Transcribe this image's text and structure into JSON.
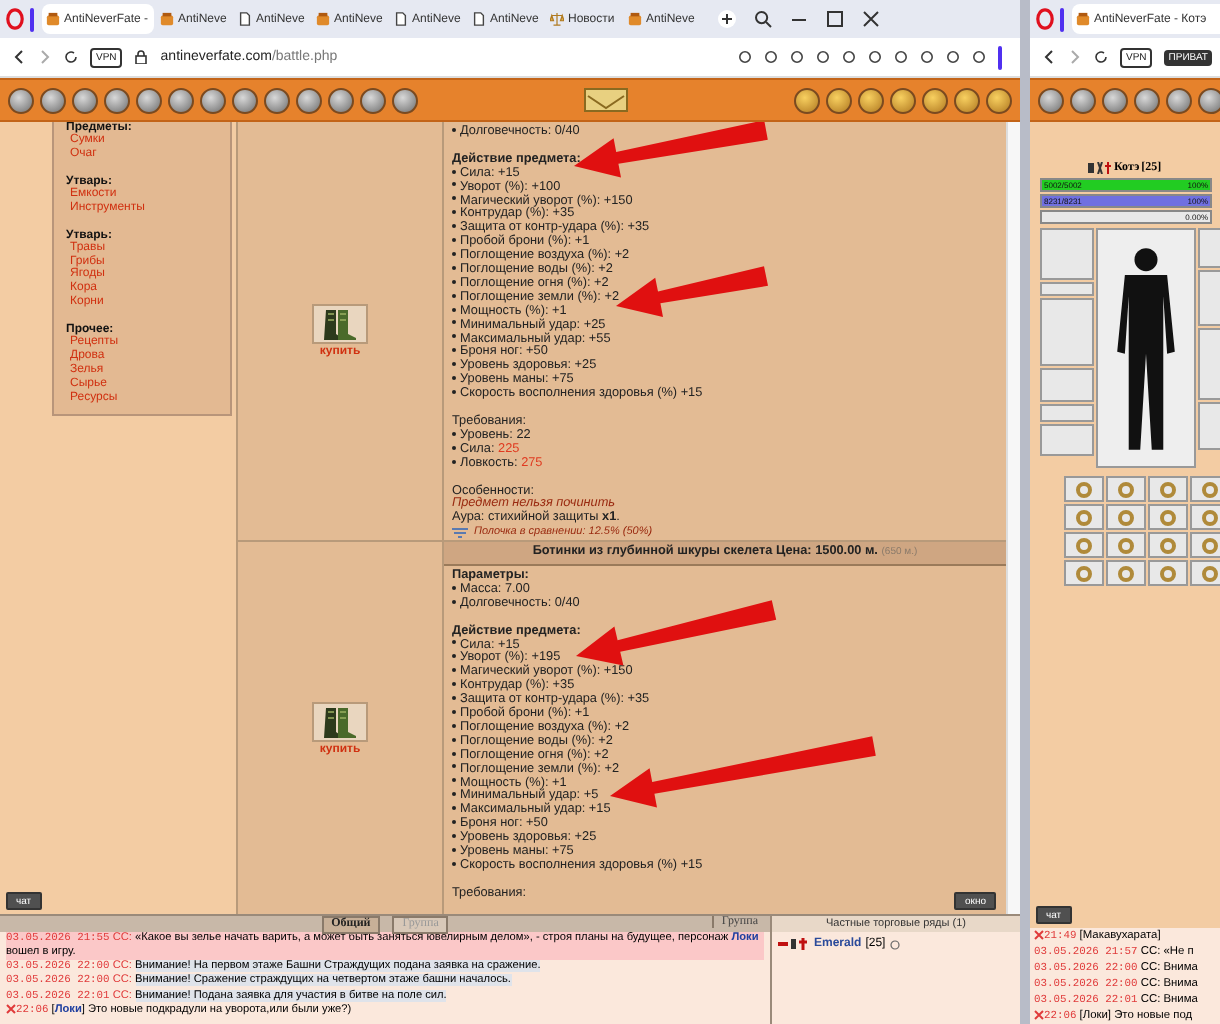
{
  "main_window": {
    "tabs": [
      {
        "title": "AntiNeverFate -",
        "kind": "game",
        "selected": true
      },
      {
        "title": "AntiNeve",
        "kind": "game",
        "selected": false
      },
      {
        "title": "AntiNeve",
        "kind": "doc",
        "selected": false
      },
      {
        "title": "AntiNeve",
        "kind": "game",
        "selected": false
      },
      {
        "title": "AntiNeve",
        "kind": "doc",
        "selected": false
      },
      {
        "title": "AntiNeve",
        "kind": "doc",
        "selected": false
      },
      {
        "title": "Новости",
        "kind": "news",
        "selected": false
      },
      {
        "title": "AntiNeve",
        "kind": "game",
        "selected": false
      }
    ],
    "address": {
      "vpn": "VPN",
      "domain": "antineverfate.com",
      "path": "/battle.php"
    },
    "sidebar": [
      {
        "title": "Предметы:",
        "items": [
          "Сумки",
          "Очаг"
        ]
      },
      {
        "title": "Утварь:",
        "items": [
          "Емкости",
          "Инструменты"
        ]
      },
      {
        "title": "Утварь:",
        "items": [
          "Травы",
          "Грибы",
          "Ягоды",
          "Кора",
          "Корни"
        ]
      },
      {
        "title": "Прочее:",
        "items": [
          "Рецепты",
          "Дрова",
          "Зелья",
          "Сырье",
          "Ресурсы"
        ]
      }
    ],
    "items": [
      {
        "buy": "купить",
        "sections": [
          {
            "kind": "stats",
            "lines": [
              "Долговечность: 0/40"
            ]
          },
          {
            "kind": "stats",
            "title": "Действие предмета:",
            "lines": [
              "Сила: +15",
              "Уворот (%): +100",
              "Магический уворот (%): +150",
              "Контрудар (%): +35",
              "Защита от контр-удара (%): +35",
              "Пробой брони (%): +1",
              "Поглощение воздуха (%): +2",
              "Поглощение воды (%): +2",
              "Поглощение огня (%): +2",
              "Поглощение земли (%): +2",
              "Мощность (%): +1",
              "Минимальный удар: +25",
              "Максимальный удар: +55",
              "Броня ног: +50",
              "Уровень здоровья: +25",
              "Уровень маны: +75",
              "Скорость восполнения здоровья (%) +15"
            ]
          },
          {
            "kind": "requirements",
            "title": "Требования:",
            "lines": [
              {
                "label": "Уровень:",
                "value": "22",
                "unmet": false
              },
              {
                "label": "Сила:",
                "value": "225",
                "unmet": true
              },
              {
                "label": "Ловкость:",
                "value": "275",
                "unmet": true
              }
            ]
          },
          {
            "kind": "features",
            "title": "Особенности:",
            "note": "Предмет нельзя починить",
            "aura": "Аура: стихийной защиты **x1**.",
            "compare": "Полочка в сравнении: 12.5% (50%)"
          }
        ]
      },
      {
        "buy": "купить",
        "header": {
          "title": "Ботинки из глубинной шкуры скелета Цена: 1500.00 м.",
          "note": "(650 м.)"
        },
        "sections": [
          {
            "kind": "stats",
            "title": "Параметры:",
            "lines": [
              "Масса: 7.00",
              "Долговечность: 0/40"
            ]
          },
          {
            "kind": "stats",
            "title": "Действие предмета:",
            "lines": [
              "Сила: +15",
              "Уворот (%): +195",
              "Магический уворот (%): +150",
              "Контрудар (%): +35",
              "Защита от контр-удара (%): +35",
              "Пробой брони (%): +1",
              "Поглощение воздуха (%): +2",
              "Поглощение воды (%): +2",
              "Поглощение огня (%): +2",
              "Поглощение земли (%): +2",
              "Мощность (%): +1",
              "Минимальный удар: +5",
              "Максимальный удар: +15",
              "Броня ног: +50",
              "Уровень здоровья: +25",
              "Уровень маны: +75",
              "Скорость восполнения здоровья (%) +15"
            ]
          },
          {
            "kind": "requirements",
            "title": "Требования:"
          }
        ]
      }
    ],
    "chat_button": "чат",
    "window_button": "окно",
    "chat_tabs": [
      {
        "label": "Общий",
        "selected": true
      },
      {
        "label": "Группа",
        "selected": false
      }
    ],
    "chat_tab_right": "Группа",
    "chat": [
      {
        "kind": "system",
        "highlighted": true,
        "time": "03.05.2026 21:55",
        "sender": "СС:",
        "text": "«Какое вы зелье начать варить, а может быть заняться ювелирным делом», - строя планы на будущее, персонаж **Локи** вошел в игру."
      },
      {
        "kind": "system",
        "highlighted": false,
        "time": "03.05.2026 22:00",
        "sender": "СС:",
        "text": "Внимание! На первом этаже Башни Страждущих подана заявка на сражение."
      },
      {
        "kind": "system",
        "highlighted": false,
        "time": "03.05.2026 22:00",
        "sender": "СС:",
        "text": "Внимание! Сражение страждущих на четвертом этаже башни началось."
      },
      {
        "kind": "system",
        "highlighted": false,
        "time": "03.05.2026 22:01",
        "sender": "СС:",
        "text": "Внимание! Подана заявка для участия в битве на поле сил."
      },
      {
        "kind": "player",
        "highlighted": false,
        "time": "22:06",
        "text": "[**Локи**] Это новые подкрадули на уворота,или были уже?)"
      }
    ],
    "trade": {
      "title": "Частные торговые ряды (1)",
      "players": [
        {
          "name": "Emerald",
          "level": "[25]"
        }
      ]
    }
  },
  "side_window": {
    "tab": "AntiNeverFate - Котэ",
    "vpn": "VPN",
    "private": "ПРИВАТ",
    "character": {
      "name": "Котэ",
      "level": "[25]",
      "bars": [
        {
          "text": "5002/5002",
          "pct": "100%",
          "level": 1,
          "color": "#22cc22"
        },
        {
          "text": "8231/8231",
          "pct": "100%",
          "level": 1,
          "color": "#7070e0"
        },
        {
          "pct": "0.00%",
          "level": 0
        }
      ]
    },
    "chat_button": "чат",
    "chat": [
      {
        "kind": "player",
        "time": "21:49",
        "text": "[Макавухарата]"
      },
      {
        "kind": "system",
        "time": "03.05.2026 21:57",
        "text": "СС: «Не п"
      },
      {
        "kind": "system",
        "time": "03.05.2026 22:00",
        "text": "СС: Внима"
      },
      {
        "kind": "system",
        "time": "03.05.2026 22:00",
        "text": "СС: Внима"
      },
      {
        "kind": "system",
        "time": "03.05.2026 22:01",
        "text": "СС: Внима"
      },
      {
        "kind": "player",
        "time": "22:06",
        "text": "[Локи] Это новые под"
      }
    ]
  }
}
